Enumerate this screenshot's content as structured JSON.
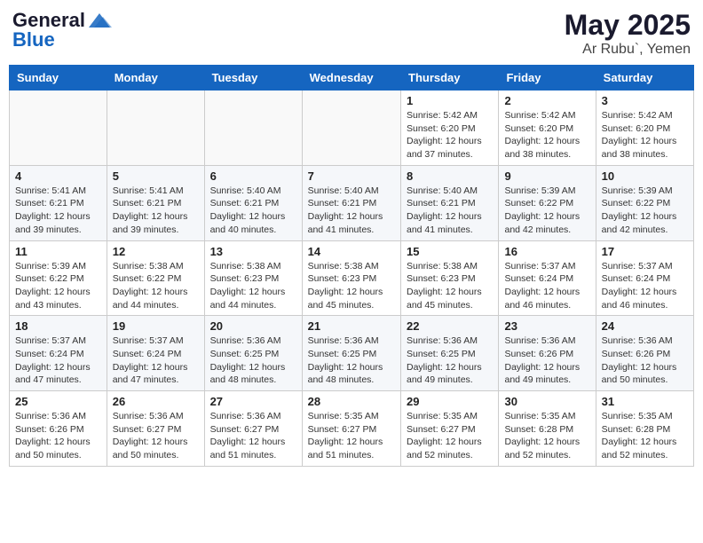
{
  "header": {
    "logo_general": "General",
    "logo_blue": "Blue",
    "month": "May 2025",
    "location": "Ar Rubu`, Yemen"
  },
  "weekdays": [
    "Sunday",
    "Monday",
    "Tuesday",
    "Wednesday",
    "Thursday",
    "Friday",
    "Saturday"
  ],
  "weeks": [
    [
      {
        "day": "",
        "info": ""
      },
      {
        "day": "",
        "info": ""
      },
      {
        "day": "",
        "info": ""
      },
      {
        "day": "",
        "info": ""
      },
      {
        "day": "1",
        "info": "Sunrise: 5:42 AM\nSunset: 6:20 PM\nDaylight: 12 hours\nand 37 minutes."
      },
      {
        "day": "2",
        "info": "Sunrise: 5:42 AM\nSunset: 6:20 PM\nDaylight: 12 hours\nand 38 minutes."
      },
      {
        "day": "3",
        "info": "Sunrise: 5:42 AM\nSunset: 6:20 PM\nDaylight: 12 hours\nand 38 minutes."
      }
    ],
    [
      {
        "day": "4",
        "info": "Sunrise: 5:41 AM\nSunset: 6:21 PM\nDaylight: 12 hours\nand 39 minutes."
      },
      {
        "day": "5",
        "info": "Sunrise: 5:41 AM\nSunset: 6:21 PM\nDaylight: 12 hours\nand 39 minutes."
      },
      {
        "day": "6",
        "info": "Sunrise: 5:40 AM\nSunset: 6:21 PM\nDaylight: 12 hours\nand 40 minutes."
      },
      {
        "day": "7",
        "info": "Sunrise: 5:40 AM\nSunset: 6:21 PM\nDaylight: 12 hours\nand 41 minutes."
      },
      {
        "day": "8",
        "info": "Sunrise: 5:40 AM\nSunset: 6:21 PM\nDaylight: 12 hours\nand 41 minutes."
      },
      {
        "day": "9",
        "info": "Sunrise: 5:39 AM\nSunset: 6:22 PM\nDaylight: 12 hours\nand 42 minutes."
      },
      {
        "day": "10",
        "info": "Sunrise: 5:39 AM\nSunset: 6:22 PM\nDaylight: 12 hours\nand 42 minutes."
      }
    ],
    [
      {
        "day": "11",
        "info": "Sunrise: 5:39 AM\nSunset: 6:22 PM\nDaylight: 12 hours\nand 43 minutes."
      },
      {
        "day": "12",
        "info": "Sunrise: 5:38 AM\nSunset: 6:22 PM\nDaylight: 12 hours\nand 44 minutes."
      },
      {
        "day": "13",
        "info": "Sunrise: 5:38 AM\nSunset: 6:23 PM\nDaylight: 12 hours\nand 44 minutes."
      },
      {
        "day": "14",
        "info": "Sunrise: 5:38 AM\nSunset: 6:23 PM\nDaylight: 12 hours\nand 45 minutes."
      },
      {
        "day": "15",
        "info": "Sunrise: 5:38 AM\nSunset: 6:23 PM\nDaylight: 12 hours\nand 45 minutes."
      },
      {
        "day": "16",
        "info": "Sunrise: 5:37 AM\nSunset: 6:24 PM\nDaylight: 12 hours\nand 46 minutes."
      },
      {
        "day": "17",
        "info": "Sunrise: 5:37 AM\nSunset: 6:24 PM\nDaylight: 12 hours\nand 46 minutes."
      }
    ],
    [
      {
        "day": "18",
        "info": "Sunrise: 5:37 AM\nSunset: 6:24 PM\nDaylight: 12 hours\nand 47 minutes."
      },
      {
        "day": "19",
        "info": "Sunrise: 5:37 AM\nSunset: 6:24 PM\nDaylight: 12 hours\nand 47 minutes."
      },
      {
        "day": "20",
        "info": "Sunrise: 5:36 AM\nSunset: 6:25 PM\nDaylight: 12 hours\nand 48 minutes."
      },
      {
        "day": "21",
        "info": "Sunrise: 5:36 AM\nSunset: 6:25 PM\nDaylight: 12 hours\nand 48 minutes."
      },
      {
        "day": "22",
        "info": "Sunrise: 5:36 AM\nSunset: 6:25 PM\nDaylight: 12 hours\nand 49 minutes."
      },
      {
        "day": "23",
        "info": "Sunrise: 5:36 AM\nSunset: 6:26 PM\nDaylight: 12 hours\nand 49 minutes."
      },
      {
        "day": "24",
        "info": "Sunrise: 5:36 AM\nSunset: 6:26 PM\nDaylight: 12 hours\nand 50 minutes."
      }
    ],
    [
      {
        "day": "25",
        "info": "Sunrise: 5:36 AM\nSunset: 6:26 PM\nDaylight: 12 hours\nand 50 minutes."
      },
      {
        "day": "26",
        "info": "Sunrise: 5:36 AM\nSunset: 6:27 PM\nDaylight: 12 hours\nand 50 minutes."
      },
      {
        "day": "27",
        "info": "Sunrise: 5:36 AM\nSunset: 6:27 PM\nDaylight: 12 hours\nand 51 minutes."
      },
      {
        "day": "28",
        "info": "Sunrise: 5:35 AM\nSunset: 6:27 PM\nDaylight: 12 hours\nand 51 minutes."
      },
      {
        "day": "29",
        "info": "Sunrise: 5:35 AM\nSunset: 6:27 PM\nDaylight: 12 hours\nand 52 minutes."
      },
      {
        "day": "30",
        "info": "Sunrise: 5:35 AM\nSunset: 6:28 PM\nDaylight: 12 hours\nand 52 minutes."
      },
      {
        "day": "31",
        "info": "Sunrise: 5:35 AM\nSunset: 6:28 PM\nDaylight: 12 hours\nand 52 minutes."
      }
    ]
  ]
}
